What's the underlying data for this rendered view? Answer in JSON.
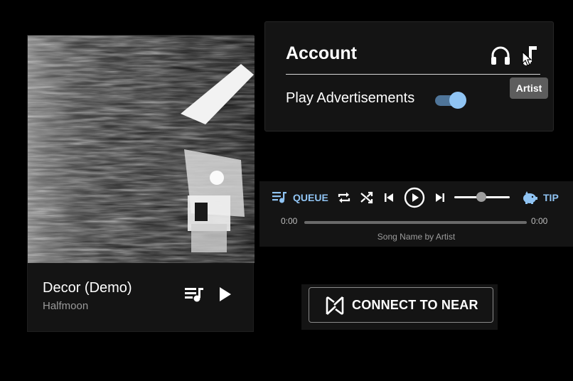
{
  "song_card": {
    "title": "Decor (Demo)",
    "artist": "Halfmoon",
    "icons": {
      "queue": "playlist-add-icon",
      "play": "play-icon"
    }
  },
  "account": {
    "title": "Account",
    "icons": {
      "listener": "headphones-icon",
      "artist": "music-note-icon"
    },
    "tooltip": "Artist",
    "ads_label": "Play Advertisements",
    "ads_enabled": true,
    "accent_color": "#90c4f3"
  },
  "player": {
    "queue_label": "QUEUE",
    "tip_label": "TIP",
    "time_elapsed": "0:00",
    "time_total": "0:00",
    "now_playing": "Song Name by Artist",
    "progress": 0,
    "volume": 0.5,
    "icons": [
      "queue-icon",
      "repeat-icon",
      "shuffle-icon",
      "skip-previous-icon",
      "play-circle-icon",
      "skip-next-icon",
      "piggy-bank-icon"
    ]
  },
  "connect": {
    "label": "CONNECT TO NEAR",
    "icon": "near-logo-icon"
  }
}
